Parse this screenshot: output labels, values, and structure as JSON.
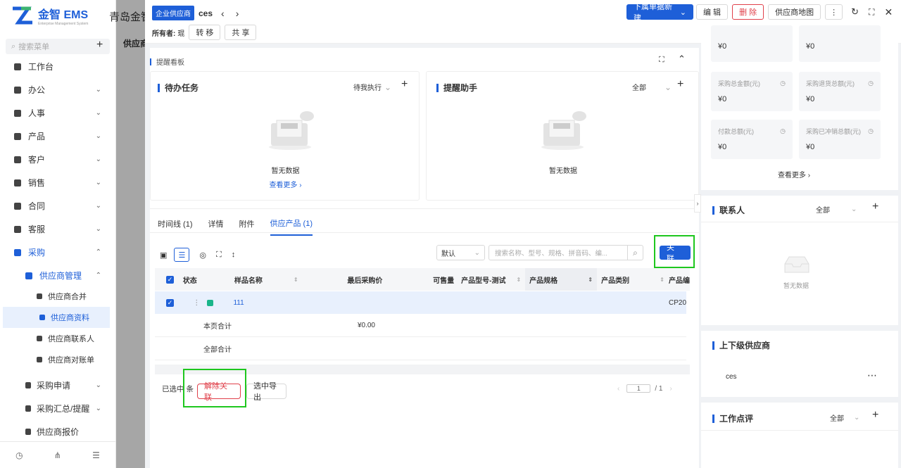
{
  "app": {
    "logo_text": "金智 EMS",
    "logo_sub": "Enterprise Management System",
    "company": "青岛金智",
    "back_title": "供应商"
  },
  "sidebar": {
    "search_placeholder": "搜索菜单",
    "items": [
      {
        "label": "工作台",
        "icon": "dashboard-icon"
      },
      {
        "label": "办公",
        "icon": "office-icon"
      },
      {
        "label": "人事",
        "icon": "people-icon"
      },
      {
        "label": "产品",
        "icon": "product-icon"
      },
      {
        "label": "客户",
        "icon": "customer-icon"
      },
      {
        "label": "销售",
        "icon": "sales-icon"
      },
      {
        "label": "合同",
        "icon": "contract-icon"
      },
      {
        "label": "客服",
        "icon": "headset-icon"
      },
      {
        "label": "采购",
        "icon": "purchase-icon"
      }
    ],
    "sub_group": "供应商管理",
    "sub_items": [
      "供应商合并",
      "供应商资料",
      "供应商联系人",
      "供应商对账单"
    ],
    "more_items": [
      "采购申请",
      "采购汇总/提醒",
      "供应商报价"
    ]
  },
  "drawer": {
    "tag": "企业供应商",
    "record_name": "ces",
    "owner_label": "所有者:",
    "owner_value": "琨",
    "transfer": "转 移",
    "share": "共 享",
    "new_sub": "下属单据新建",
    "edit": "编 辑",
    "delete": "删 除",
    "map": "供应商地图"
  },
  "reminder": {
    "title": "提醒看板",
    "todo_title": "待办任务",
    "todo_filter": "待我执行",
    "assistant_title": "提醒助手",
    "assistant_filter": "全部",
    "empty": "暂无数据",
    "view_more": "查看更多"
  },
  "tabs": [
    "时间线 (1)",
    "详情",
    "附件",
    "供应产品 (1)"
  ],
  "toolbar": {
    "sort_value": "默认",
    "search_placeholder": "搜索名称、型号、规格、拼音码、编...",
    "link_btn": "关 联"
  },
  "table": {
    "headers": [
      "状态",
      "样品名称",
      "最后采购价",
      "可售量",
      "产品型号-测试",
      "产品规格",
      "产品类别",
      "产品编"
    ],
    "row": {
      "name": "111",
      "code": "CP20"
    },
    "page_total_label": "本页合计",
    "page_total_value": "¥0.00",
    "all_total_label": "全部合计"
  },
  "footer": {
    "selected_prefix": "已选中",
    "selected_suffix": "条",
    "unlink": "解除关联",
    "export": "选中导出",
    "page": "1",
    "total_pages": "/ 1"
  },
  "stats": [
    {
      "label": "",
      "value": "¥0"
    },
    {
      "label": "",
      "value": "¥0"
    },
    {
      "label": "采购总金额(元)",
      "value": "¥0"
    },
    {
      "label": "采购退货总额(元)",
      "value": "¥0"
    },
    {
      "label": "付款总额(元)",
      "value": "¥0"
    },
    {
      "label": "采购已冲销总额(元)",
      "value": "¥0"
    }
  ],
  "stats_more": "查看更多",
  "contacts": {
    "title": "联系人",
    "filter": "全部",
    "empty": "暂无数据"
  },
  "hierarchy": {
    "title": "上下级供应商",
    "item": "ces"
  },
  "comments": {
    "title": "工作点评",
    "filter": "全部"
  },
  "colors": {
    "primary": "#1e5fd8",
    "danger": "#e0404a",
    "highlight": "#1ec71e"
  }
}
